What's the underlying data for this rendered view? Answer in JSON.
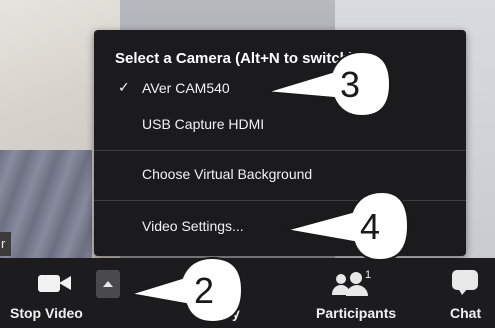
{
  "background": {
    "edge_label": "r"
  },
  "camera_menu": {
    "header": "Select a Camera (Alt+N to switch)",
    "cameras": [
      {
        "label": "AVer CAM540",
        "selected": true,
        "check": "✓"
      },
      {
        "label": "USB Capture HDMI",
        "selected": false,
        "check": ""
      }
    ],
    "virtual_background_label": "Choose Virtual Background",
    "video_settings_label": "Video Settings..."
  },
  "toolbar": {
    "stop_video_label": "Stop Video",
    "hidden_label": "y",
    "participants_label": "Participants",
    "participants_count": "1",
    "chat_label": "Chat",
    "icons": [
      "video-camera-icon",
      "caret-up-icon",
      "participants-icon",
      "chat-icon"
    ]
  },
  "callouts": [
    {
      "number": "3"
    },
    {
      "number": "4"
    },
    {
      "number": "2"
    }
  ],
  "colors": {
    "toolbar_bg": "#1c1c1e",
    "menu_bg": "#1b1b1d",
    "callout_fill": "#ffffff"
  }
}
